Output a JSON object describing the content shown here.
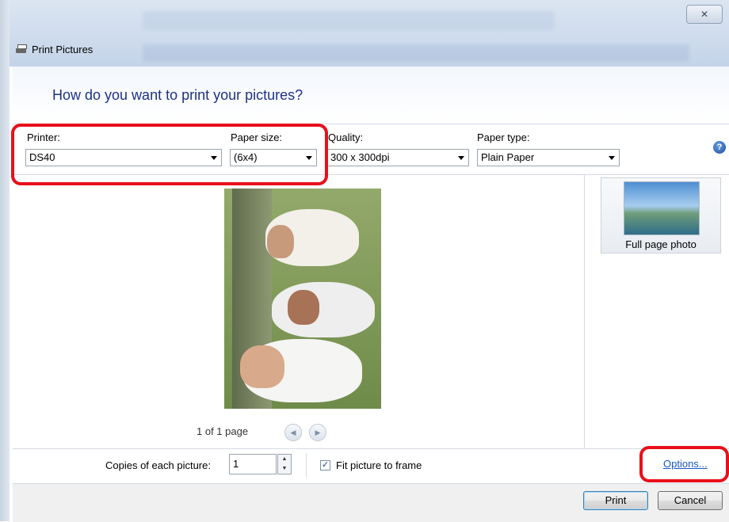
{
  "window": {
    "title": "Print Pictures",
    "close_glyph": "✕"
  },
  "heading": "How do you want to print your pictures?",
  "fields": {
    "printer": {
      "label": "Printer:",
      "value": "DS40"
    },
    "paper_size": {
      "label": "Paper size:",
      "value": "(6x4)"
    },
    "quality": {
      "label": "Quality:",
      "value": "300 x 300dpi"
    },
    "paper_type": {
      "label": "Paper type:",
      "value": "Plain Paper"
    }
  },
  "help_glyph": "?",
  "pager": {
    "text": "1 of 1 page",
    "prev_glyph": "◀",
    "next_glyph": "▶"
  },
  "layout_option": {
    "label": "Full page photo"
  },
  "copies": {
    "label": "Copies of each picture:",
    "value": "1",
    "up_glyph": "▲",
    "down_glyph": "▼"
  },
  "fit": {
    "label": "Fit picture to frame",
    "checked_glyph": "✓"
  },
  "options_link": "Options...",
  "buttons": {
    "print": "Print",
    "cancel": "Cancel"
  },
  "colors": {
    "highlight": "#e8101a",
    "heading": "#1e3287",
    "link": "#1a57c6"
  }
}
